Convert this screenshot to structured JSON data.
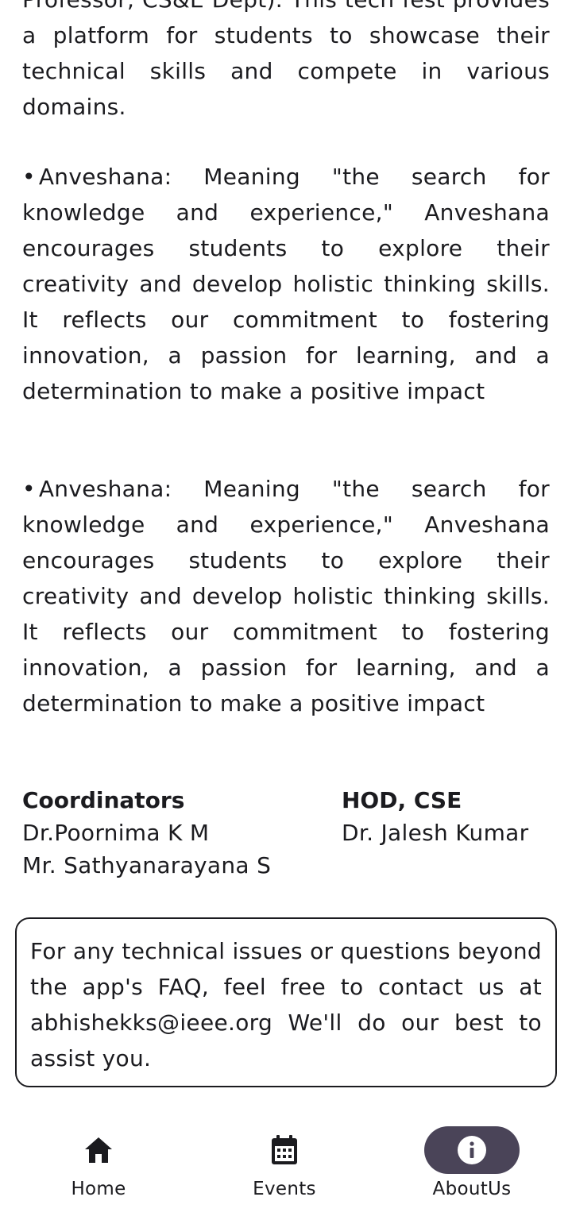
{
  "intro": {
    "text": "Professor, CS&E Dept). This tech fest provides a platform for students to showcase their technical skills and compete in various domains."
  },
  "bullets": [
    {
      "bullet": "•",
      "text": "Anveshana: Meaning \"the search for knowledge and experience,\" Anveshana encourages students to explore their creativity and develop holistic thinking skills. It reflects our commitment to fostering innovation, a passion for learning, and a determination to make a positive impact"
    },
    {
      "bullet": "•",
      "text": "Anveshana: Meaning \"the search for knowledge and experience,\" Anveshana encourages students to explore their creativity and develop holistic thinking skills. It reflects our commitment to fostering innovation, a passion for learning, and a determination to make a positive impact"
    }
  ],
  "coordinators": {
    "title": "Coordinators",
    "names": [
      "Dr.Poornima K M",
      "Mr. Sathyanarayana S"
    ]
  },
  "hod": {
    "title": "HOD, CSE",
    "name": "Dr. Jalesh Kumar"
  },
  "contact": {
    "text": "For any technical issues or questions beyond the app's FAQ, feel free to contact us at abhishekks@ieee.org We'll do our best to assist you."
  },
  "nav": {
    "items": [
      {
        "label": "Home",
        "icon": "home-icon"
      },
      {
        "label": "Events",
        "icon": "calendar-icon"
      },
      {
        "label": "AboutUs",
        "icon": "info-icon",
        "active": true
      }
    ],
    "active_color": "#4a4458"
  }
}
